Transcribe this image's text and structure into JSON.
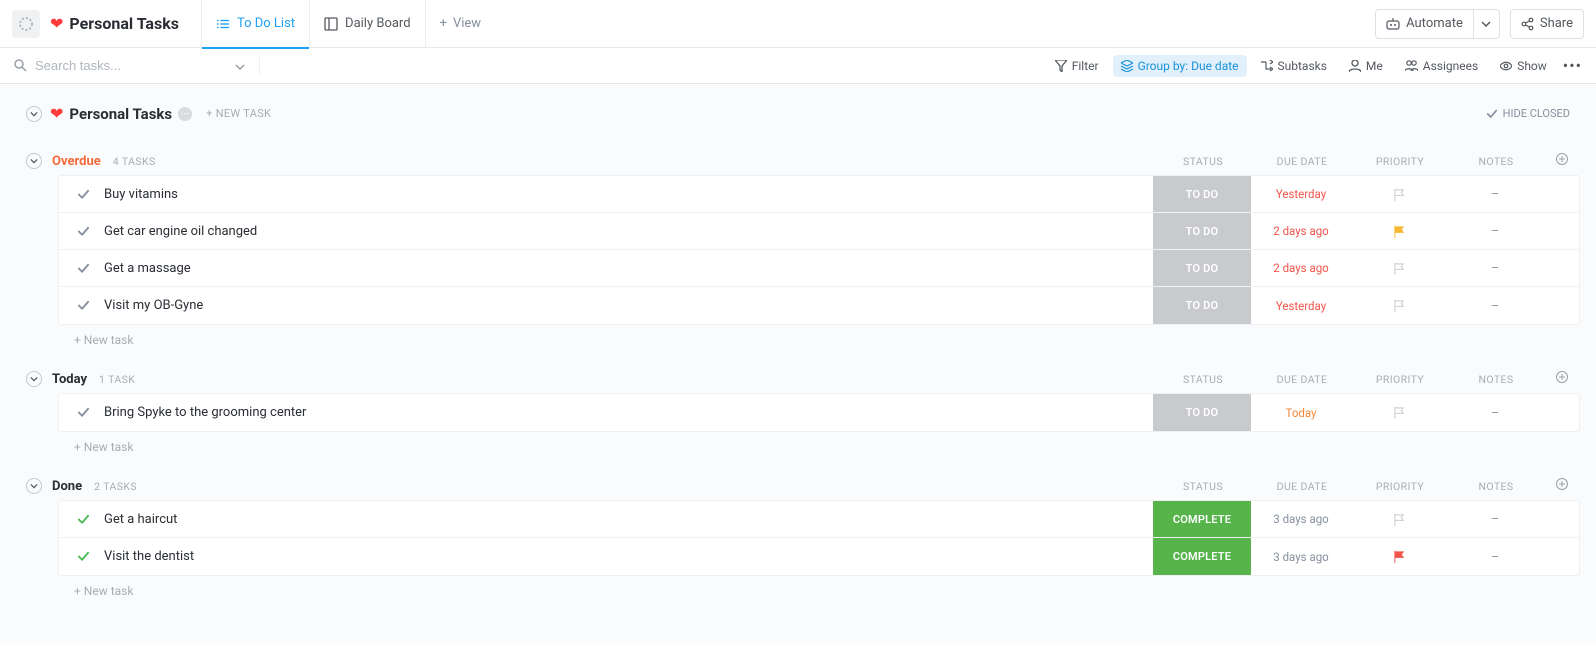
{
  "header": {
    "list_name": "Personal Tasks",
    "tabs": {
      "todo": "To Do List",
      "daily": "Daily Board",
      "add_view": "View"
    },
    "automate": "Automate",
    "share": "Share"
  },
  "filterbar": {
    "search_placeholder": "Search tasks...",
    "filter": "Filter",
    "group_by": "Group by: Due date",
    "subtasks": "Subtasks",
    "me": "Me",
    "assignees": "Assignees",
    "show": "Show"
  },
  "main": {
    "list_title": "Personal Tasks",
    "new_task_top": "+ NEW TASK",
    "hide_closed": "HIDE CLOSED",
    "columns": {
      "status": "STATUS",
      "due": "DUE DATE",
      "priority": "PRIORITY",
      "notes": "NOTES"
    },
    "new_task_label": "+ New task"
  },
  "groups": {
    "overdue": {
      "name": "Overdue",
      "count": "4 TASKS",
      "tasks": [
        {
          "name": "Buy vitamins",
          "status": "TO DO",
          "due": "Yesterday",
          "due_style": "overdue",
          "priority": "grey"
        },
        {
          "name": "Get car engine oil changed",
          "status": "TO DO",
          "due": "2 days ago",
          "due_style": "overdue",
          "priority": "yellow"
        },
        {
          "name": "Get a massage",
          "status": "TO DO",
          "due": "2 days ago",
          "due_style": "overdue",
          "priority": "grey"
        },
        {
          "name": "Visit my OB-Gyne",
          "status": "TO DO",
          "due": "Yesterday",
          "due_style": "overdue",
          "priority": "grey"
        }
      ]
    },
    "today": {
      "name": "Today",
      "count": "1 TASK",
      "tasks": [
        {
          "name": "Bring Spyke to the grooming center",
          "status": "TO DO",
          "due": "Today",
          "due_style": "today",
          "priority": "grey"
        }
      ]
    },
    "done": {
      "name": "Done",
      "count": "2 TASKS",
      "tasks": [
        {
          "name": "Get a haircut",
          "status": "COMPLETE",
          "due": "3 days ago",
          "due_style": "neutral",
          "priority": "grey",
          "done": true
        },
        {
          "name": "Visit the dentist",
          "status": "COMPLETE",
          "due": "3 days ago",
          "due_style": "neutral",
          "priority": "red",
          "done": true
        }
      ]
    }
  }
}
